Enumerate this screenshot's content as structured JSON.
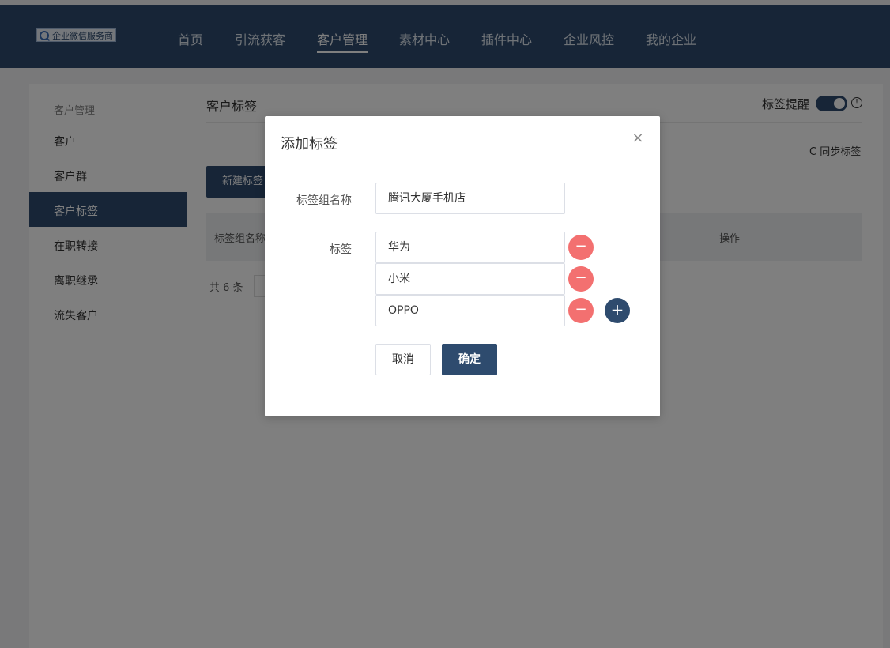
{
  "header": {
    "logo_text": "企业微信服务商",
    "nav": [
      "首页",
      "引流获客",
      "客户管理",
      "素材中心",
      "插件中心",
      "企业风控",
      "我的企业"
    ],
    "active_nav": "客户管理"
  },
  "sidebar": {
    "group_title": "客户管理",
    "items": [
      "客户",
      "客户群",
      "客户标签",
      "在职转接",
      "离职继承",
      "流失客户"
    ],
    "active": "客户标签"
  },
  "main": {
    "title": "客户标签",
    "remind_label": "标签提醒",
    "info_icon": "!",
    "sync_label": "同步标签",
    "sync_icon": "C",
    "new_button": "新建标签",
    "table_headers": [
      "标签组名称",
      "操作"
    ],
    "total_text": "共 6 条"
  },
  "modal": {
    "title": "添加标签",
    "close_icon": "×",
    "group_label": "标签组名称",
    "group_value": "腾讯大厦手机店",
    "tags_label": "标签",
    "tags": [
      "华为",
      "小米",
      "OPPO"
    ],
    "minus_icon": "−",
    "plus_icon": "+",
    "cancel": "取消",
    "confirm": "确定"
  },
  "colors": {
    "primary": "#2e4b6e",
    "danger": "#f37070"
  }
}
